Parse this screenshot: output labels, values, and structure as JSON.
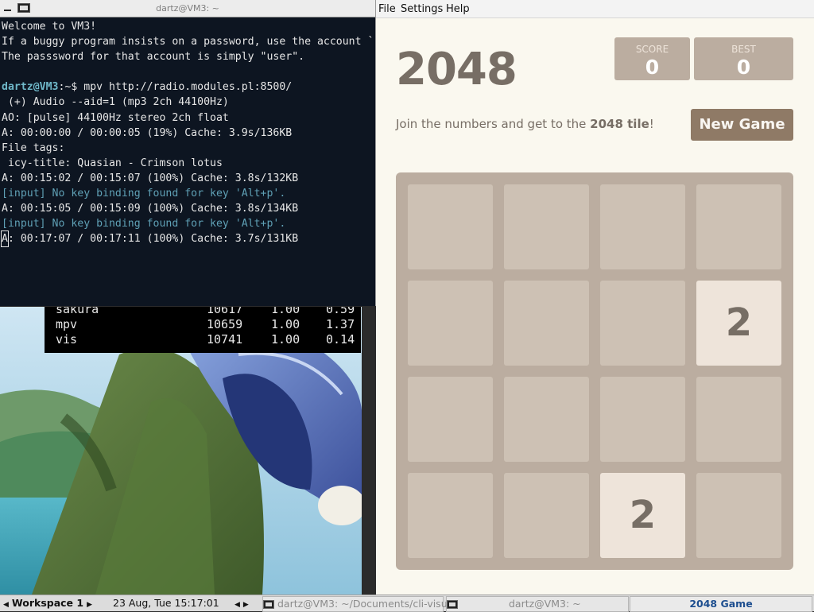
{
  "terminal": {
    "title": "dartz@VM3: ~",
    "lines": [
      {
        "text": "Welcome to VM3!"
      },
      {
        "text": "If a buggy program insists on a password, use the account `"
      },
      {
        "text": "The passsword for that account is simply \"user\"."
      },
      {
        "text": ""
      },
      {
        "prompt_user": "dartz@VM3",
        "text": ":~$ mpv http://radio.modules.pl:8500/"
      },
      {
        "text": " (+) Audio --aid=1 (mp3 2ch 44100Hz)"
      },
      {
        "text": "AO: [pulse] 44100Hz stereo 2ch float"
      },
      {
        "text": "A: 00:00:00 / 00:00:05 (19%) Cache: 3.9s/136KB"
      },
      {
        "text": "File tags:"
      },
      {
        "text": " icy-title: Quasian - Crimson lotus"
      },
      {
        "text": "A: 00:15:02 / 00:15:07 (100%) Cache: 3.8s/132KB"
      },
      {
        "text": "[input] No key binding found for key 'Alt+p'.",
        "info": true
      },
      {
        "text": "A: 00:15:05 / 00:15:09 (100%) Cache: 3.8s/134KB"
      },
      {
        "text": "[input] No key binding found for key 'Alt+p'.",
        "info": true
      },
      {
        "cursor": "A",
        "text": ": 00:17:07 / 00:17:11 (100%) Cache: 3.7s/131KB"
      }
    ]
  },
  "process_list": {
    "rows": [
      [
        "sakura",
        "10617",
        "1.00",
        "0.59"
      ],
      [
        "mpv",
        "10659",
        "1.00",
        "1.37"
      ],
      [
        "vis",
        "10741",
        "1.00",
        "0.14"
      ]
    ]
  },
  "game": {
    "menu": [
      "File",
      "Settings",
      "Help"
    ],
    "title": "2048",
    "score_label": "SCORE",
    "score": "0",
    "best_label": "BEST",
    "best": "0",
    "intro_prefix": "Join the numbers and get to the ",
    "intro_bold": "2048 tile",
    "intro_suffix": "!",
    "new_game_label": "New Game",
    "grid": [
      [
        "",
        "",
        "",
        ""
      ],
      [
        "",
        "",
        "",
        "2"
      ],
      [
        "",
        "",
        "",
        ""
      ],
      [
        "",
        "",
        "2",
        ""
      ]
    ]
  },
  "taskbar": {
    "workspace": "Workspace 1",
    "datetime": "23 Aug, Tue 15:17:01",
    "tasks": [
      "dartz@VM3: ~/Documents/cli-visualize",
      "dartz@VM3: ~"
    ],
    "active_task": "2048 Game"
  },
  "colors": {
    "terminal_bg": "#0d1521",
    "board_bg": "#bbada0",
    "empty_cell": "#cdc1b4",
    "tile_2": "#eee4da",
    "button": "#8f7a66"
  }
}
